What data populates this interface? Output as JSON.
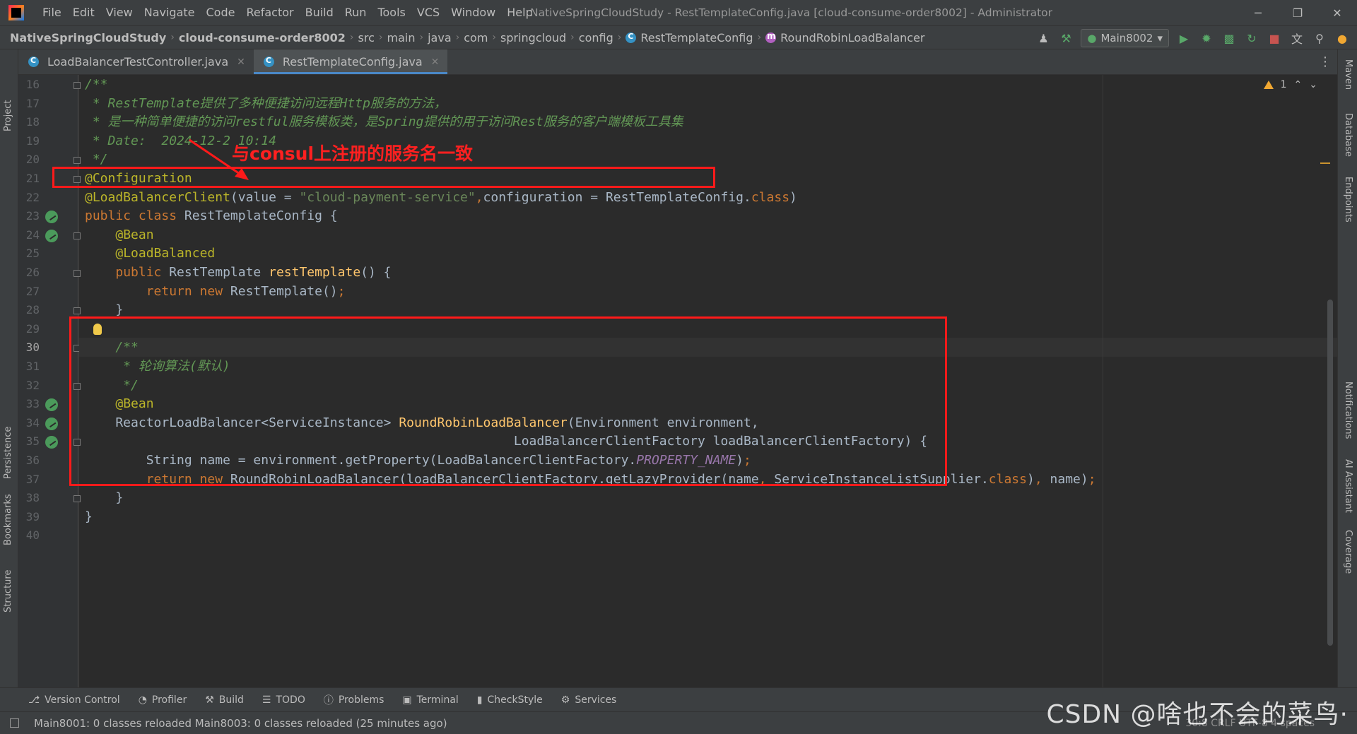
{
  "window": {
    "title": "NativeSpringCloudStudy - RestTemplateConfig.java [cloud-consume-order8002] - Administrator",
    "menu": [
      "File",
      "Edit",
      "View",
      "Navigate",
      "Code",
      "Refactor",
      "Build",
      "Run",
      "Tools",
      "VCS",
      "Window",
      "Help"
    ],
    "controls": {
      "minimize": "─",
      "restore": "❐",
      "close": "✕"
    }
  },
  "breadcrumb": [
    {
      "label": "NativeSpringCloudStudy",
      "kind": "project"
    },
    {
      "label": "cloud-consume-order8002",
      "kind": "module"
    },
    {
      "label": "src",
      "kind": "folder"
    },
    {
      "label": "main",
      "kind": "folder"
    },
    {
      "label": "java",
      "kind": "folder"
    },
    {
      "label": "com",
      "kind": "folder"
    },
    {
      "label": "springcloud",
      "kind": "folder"
    },
    {
      "label": "config",
      "kind": "folder"
    },
    {
      "label": "RestTemplateConfig",
      "kind": "class"
    },
    {
      "label": "RoundRobinLoadBalancer",
      "kind": "method"
    }
  ],
  "toolbar": {
    "run_config": "Main8002"
  },
  "tabs": [
    {
      "label": "LoadBalancerTestController.java",
      "active": false
    },
    {
      "label": "RestTemplateConfig.java",
      "active": true
    }
  ],
  "left_strip": [
    "Project",
    "Persistence",
    "Bookmarks",
    "Structure"
  ],
  "right_strip": [
    "Maven",
    "Database",
    "Endpoints",
    "Notifications",
    "AI Assistant",
    "Coverage"
  ],
  "editor": {
    "warnings": "1",
    "current_line": 30,
    "lines": [
      {
        "n": 16,
        "tokens": [
          [
            "c-comment",
            "/**"
          ]
        ]
      },
      {
        "n": 17,
        "tokens": [
          [
            "c-comment",
            " * RestTemplate提供了多种便捷访问远程Http服务的方法，"
          ]
        ]
      },
      {
        "n": 18,
        "tokens": [
          [
            "c-comment",
            " * 是一种简单便捷的访问restful服务模板类，是Spring提供的用于访问Rest服务的客户端模板工具集"
          ]
        ]
      },
      {
        "n": 19,
        "tokens": [
          [
            "c-comment",
            " * Date:  2024-12-2 10:14"
          ]
        ]
      },
      {
        "n": 20,
        "tokens": [
          [
            "c-comment",
            " */"
          ]
        ]
      },
      {
        "n": 21,
        "tokens": [
          [
            "c-annot",
            "@Configuration"
          ]
        ]
      },
      {
        "n": 22,
        "tokens": [
          [
            "c-annot",
            "@LoadBalancerClient"
          ],
          [
            "c-plain",
            "(value = "
          ],
          [
            "c-str",
            "\"cloud-payment-service\""
          ],
          [
            "c-kw",
            ","
          ],
          [
            "c-plain",
            "configuration = RestTemplateConfig."
          ],
          [
            "c-kw",
            "class"
          ],
          [
            "c-plain",
            ")"
          ]
        ]
      },
      {
        "n": 23,
        "tokens": [
          [
            "c-kw",
            "public class "
          ],
          [
            "c-plain",
            "RestTemplateConfig {"
          ]
        ]
      },
      {
        "n": 24,
        "tokens": [
          [
            "c-plain",
            "    "
          ],
          [
            "c-annot",
            "@Bean"
          ]
        ]
      },
      {
        "n": 25,
        "tokens": [
          [
            "c-plain",
            "    "
          ],
          [
            "c-annot",
            "@LoadBalanced"
          ]
        ]
      },
      {
        "n": 26,
        "tokens": [
          [
            "c-plain",
            "    "
          ],
          [
            "c-kw",
            "public "
          ],
          [
            "c-plain",
            "RestTemplate "
          ],
          [
            "c-fn",
            "restTemplate"
          ],
          [
            "c-plain",
            "() {"
          ]
        ]
      },
      {
        "n": 27,
        "tokens": [
          [
            "c-plain",
            "        "
          ],
          [
            "c-kw",
            "return new "
          ],
          [
            "c-plain",
            "RestTemplate()"
          ],
          [
            "c-kw",
            ";"
          ]
        ]
      },
      {
        "n": 28,
        "tokens": [
          [
            "c-plain",
            "    }"
          ]
        ]
      },
      {
        "n": 29,
        "tokens": [
          [
            "c-plain",
            ""
          ]
        ]
      },
      {
        "n": 30,
        "tokens": [
          [
            "c-plain",
            "    "
          ],
          [
            "c-comment",
            "/**"
          ]
        ]
      },
      {
        "n": 31,
        "tokens": [
          [
            "c-plain",
            "    "
          ],
          [
            "c-comment",
            " * 轮询算法(默认)"
          ]
        ]
      },
      {
        "n": 32,
        "tokens": [
          [
            "c-plain",
            "    "
          ],
          [
            "c-comment",
            " */"
          ]
        ]
      },
      {
        "n": 33,
        "tokens": [
          [
            "c-plain",
            "    "
          ],
          [
            "c-annot",
            "@Bean"
          ]
        ]
      },
      {
        "n": 34,
        "tokens": [
          [
            "c-plain",
            "    ReactorLoadBalancer<ServiceInstance> "
          ],
          [
            "c-fn",
            "RoundRobinLoadBalancer"
          ],
          [
            "c-plain",
            "(Environment environment,"
          ]
        ]
      },
      {
        "n": 35,
        "tokens": [
          [
            "c-plain",
            "                                                        LoadBalancerClientFactory loadBalancerClientFactory) {"
          ]
        ]
      },
      {
        "n": 36,
        "tokens": [
          [
            "c-plain",
            "        String name = environment.getProperty(LoadBalancerClientFactory."
          ],
          [
            "c-const",
            "PROPERTY_NAME"
          ],
          [
            "c-plain",
            ")"
          ],
          [
            "c-kw",
            ";"
          ]
        ]
      },
      {
        "n": 37,
        "tokens": [
          [
            "c-plain",
            "        "
          ],
          [
            "c-kw",
            "return new "
          ],
          [
            "c-plain",
            "RoundRobinLoadBalancer(loadBalancerClientFactory.getLazyProvider(name"
          ],
          [
            "c-kw",
            ", "
          ],
          [
            "c-plain",
            "ServiceInstanceListSupplier."
          ],
          [
            "c-kw",
            "class"
          ],
          [
            "c-plain",
            ")"
          ],
          [
            "c-kw",
            ", "
          ],
          [
            "c-plain",
            "name)"
          ],
          [
            "c-kw",
            ";"
          ]
        ]
      },
      {
        "n": 38,
        "tokens": [
          [
            "c-plain",
            "    }"
          ]
        ]
      },
      {
        "n": 39,
        "tokens": [
          [
            "c-plain",
            "}"
          ]
        ]
      },
      {
        "n": 40,
        "tokens": [
          [
            "c-plain",
            ""
          ]
        ]
      }
    ],
    "bean_gutter_lines": [
      23,
      24,
      33,
      34,
      35
    ]
  },
  "annotation": {
    "text": "与consul上注册的服务名一致",
    "color": "#ff1a1a"
  },
  "bottom_tools": [
    "Version Control",
    "Profiler",
    "Build",
    "TODO",
    "Problems",
    "Terminal",
    "CheckStyle",
    "Services"
  ],
  "status": {
    "message": "Main8001: 0 classes reloaded Main8003: 0 classes reloaded (25 minutes ago)",
    "right": "30:8   CRLF   UTF-8   4 spaces"
  },
  "watermark": "CSDN @啥也不会的菜鸟·"
}
